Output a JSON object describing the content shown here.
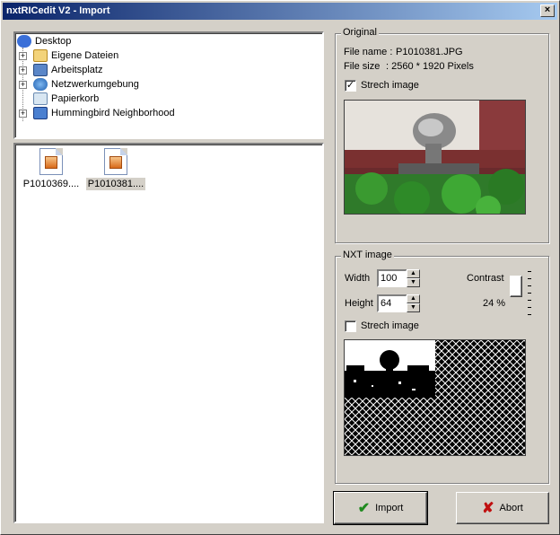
{
  "window": {
    "title": "nxtRICedit V2 - Import",
    "close_symbol": "×"
  },
  "tree": {
    "items": [
      {
        "label": "Desktop",
        "icon": "desktop-icon"
      },
      {
        "label": "Eigene Dateien",
        "icon": "folder-icon"
      },
      {
        "label": "Arbeitsplatz",
        "icon": "computer-icon"
      },
      {
        "label": "Netzwerkumgebung",
        "icon": "network-icon"
      },
      {
        "label": "Papierkorb",
        "icon": "recycle-bin-icon"
      },
      {
        "label": "Hummingbird Neighborhood",
        "icon": "network-drive-icon"
      }
    ],
    "expander_symbol": "+"
  },
  "files": [
    {
      "label": "P1010369....",
      "icon": "image-file-icon",
      "selected": false
    },
    {
      "label": "P1010381....",
      "icon": "image-file-icon",
      "selected": true
    }
  ],
  "original": {
    "legend": "Original",
    "file_name_label": "File name :",
    "file_name_value": "P1010381.JPG",
    "file_size_label": "File size",
    "file_size_value": ":  2560 * 1920 Pixels",
    "stretch_label": "Strech image",
    "stretch_checked": true,
    "check_mark": "✓"
  },
  "nxt": {
    "legend": "NXT image",
    "width_label": "Width",
    "width_value": "100",
    "height_label": "Height",
    "height_value": "64",
    "contrast_label": "Contrast",
    "contrast_value": "24 %",
    "contrast_level": 0.24,
    "stretch_label": "Strech image",
    "stretch_checked": false,
    "spin_up": "▲",
    "spin_down": "▼"
  },
  "buttons": {
    "import_label": "Import",
    "import_icon": "checkmark-icon",
    "import_glyph": "✔",
    "abort_label": "Abort",
    "abort_icon": "x-icon",
    "abort_glyph": "✘"
  },
  "colors": {
    "title_start": "#0a246a",
    "title_end": "#a6caf0",
    "face": "#d4d0c8",
    "import_icon": "#1f8a1f",
    "abort_icon": "#c01010"
  }
}
